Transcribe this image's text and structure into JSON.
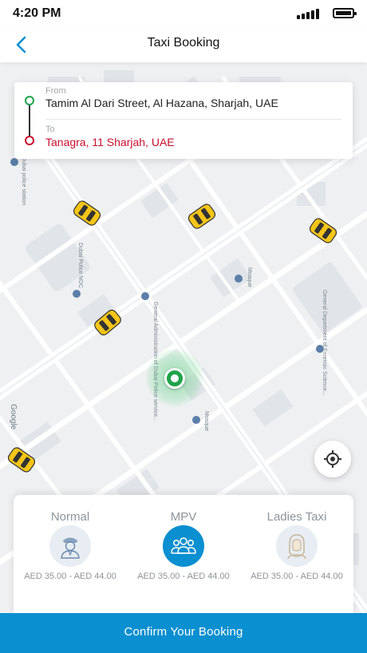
{
  "status_bar": {
    "time": "4:20 PM"
  },
  "nav": {
    "title": "Taxi Booking"
  },
  "route": {
    "from_label": "From",
    "from_value": "Tamim Al Dari Street, Al Hazana, Sharjah, UAE",
    "to_label": "To",
    "to_value": "Tanagra, 11 Sharjah, UAE"
  },
  "map": {
    "labels": {
      "police_station": "Dubai police station",
      "police_noc": "Dubai Police NOC",
      "general_admin": "General Administration of Dubai Police service...",
      "mosque_1": "Mosque",
      "mosque_2": "Mosque",
      "forensic": "General Department of Forensic Science...",
      "google": "Google"
    }
  },
  "vehicles": [
    {
      "name": "Normal",
      "price": "AED 35.00 - AED 44.00",
      "icon": "driver-icon",
      "selected": false
    },
    {
      "name": "MPV",
      "price": "AED 35.00 - AED 44.00",
      "icon": "group-icon",
      "selected": true
    },
    {
      "name": "Ladies Taxi",
      "price": "AED 35.00 - AED 44.00",
      "icon": "lady-icon",
      "selected": false
    }
  ],
  "actions": {
    "confirm_label": "Confirm Your Booking"
  },
  "colors": {
    "primary": "#0a8fd0",
    "from_dot": "#1aa34a",
    "to_dot": "#c8102e",
    "taxi": "#f5c518",
    "location_pin": "#1fa34a"
  }
}
